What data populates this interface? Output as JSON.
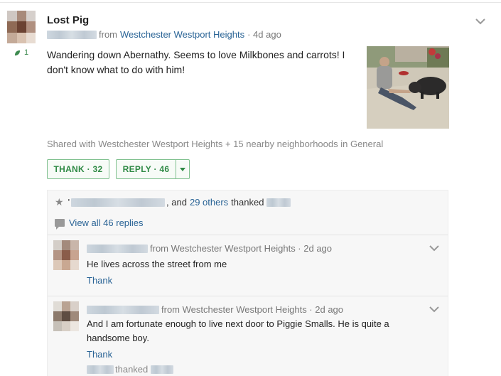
{
  "post": {
    "title": "Lost Pig",
    "from_prefix": "from",
    "neighborhood": "Westchester Westport Heights",
    "time": "· 4d ago",
    "thank_side_count": "1",
    "body": "Wandering down Abernathy. Seems to love Milkbones and carrots! I don't know what to do with him!",
    "shared": "Shared with Westchester Westport Heights + 15 nearby neighborhoods in General",
    "thank_button": "THANK · 32",
    "reply_button": "REPLY · 46"
  },
  "thanked_summary": {
    "leading": "'",
    "middle": ", and",
    "others_link": "29 others",
    "trailing": "thanked"
  },
  "view_all": "View all 46 replies",
  "replies": [
    {
      "from_text": "from Westchester Westport Heights · 2d ago",
      "text": "He lives across the street from me",
      "thank": "Thank"
    },
    {
      "from_text": "from Westchester Westport Heights · 2d ago",
      "text": "And I am fortunate enough to live next door to Piggie Smalls. He is quite a handsome boy.",
      "thank": "Thank",
      "thanked": "thanked"
    }
  ],
  "icons": {
    "leaf": "leaf-icon",
    "caret": "chevron-down-icon",
    "star": "star-icon",
    "bubble": "speech-bubble-icon"
  },
  "colors": {
    "accent_green": "#2f8a45",
    "link_blue": "#2a6496"
  }
}
